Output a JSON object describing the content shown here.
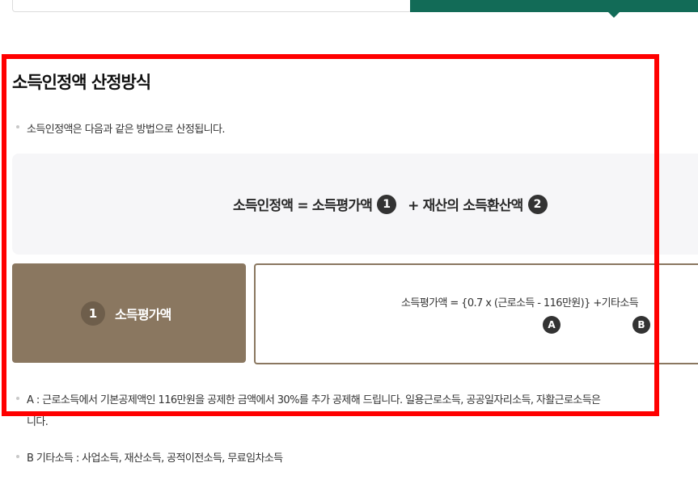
{
  "section": {
    "title": "소득인정액 산정방식",
    "intro": "소득인정액은 다음과 같은 방법으로 산정됩니다."
  },
  "formula": {
    "lhs": "소득인정액 = 소득평가액",
    "badge1": "1",
    "plus_term": "+ 재산의 소득환산액",
    "badge2": "2"
  },
  "income_card": {
    "number": "1",
    "label": "소득평가액"
  },
  "detail": {
    "formula": "소득평가액 = {0.7 x (근로소득 - 116만원)} +기타소득",
    "badge_a": "A",
    "badge_b": "B"
  },
  "notes": {
    "a_line1": "A : 근로소득에서 기본공제액인 116만원을 공제한 금액에서 30%를 추가 공제해 드립니다. 일용근로소득, 공공일자리소득, 자활근로소득은",
    "a_line2": "니다.",
    "b_line": "B 기타소득 : 사업소득, 재산소득, 공적이전소득, 무료임차소득"
  },
  "colors": {
    "tab_green": "#126b57",
    "card_brown": "#8a7760",
    "highlight_red": "#ff0000"
  }
}
